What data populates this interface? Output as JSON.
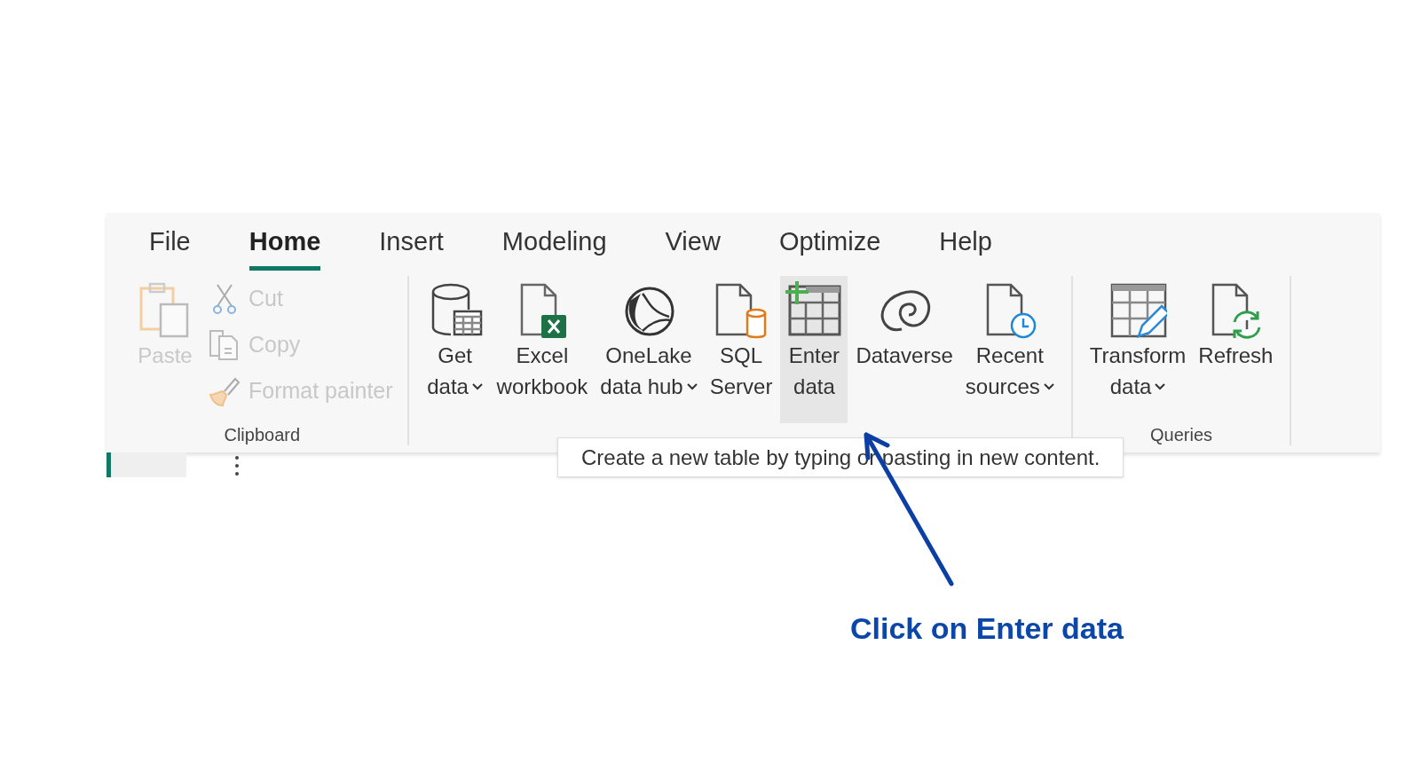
{
  "tabs": [
    {
      "label": "File",
      "selected": false
    },
    {
      "label": "Home",
      "selected": true
    },
    {
      "label": "Insert",
      "selected": false
    },
    {
      "label": "Modeling",
      "selected": false
    },
    {
      "label": "View",
      "selected": false
    },
    {
      "label": "Optimize",
      "selected": false
    },
    {
      "label": "Help",
      "selected": false
    }
  ],
  "groups": [
    {
      "label": "Clipboard",
      "items": [
        {
          "kind": "large",
          "lines": [
            "Paste"
          ],
          "disabled": true
        },
        {
          "kind": "small",
          "lines": [
            "Cut"
          ],
          "disabled": true
        },
        {
          "kind": "small",
          "lines": [
            "Copy"
          ],
          "disabled": true
        },
        {
          "kind": "small",
          "lines": [
            "Format painter"
          ],
          "disabled": true
        }
      ]
    },
    {
      "items": [
        {
          "kind": "large",
          "lines": [
            "Get",
            "data"
          ],
          "disabled": false,
          "dropdown": true,
          "highlighted": false
        },
        {
          "kind": "large",
          "lines": [
            "Excel",
            "workbook"
          ],
          "disabled": false,
          "dropdown": false,
          "highlighted": false
        },
        {
          "kind": "large",
          "lines": [
            "OneLake",
            "data hub"
          ],
          "disabled": false,
          "dropdown": true,
          "highlighted": false
        },
        {
          "kind": "large",
          "lines": [
            "SQL",
            "Server"
          ],
          "disabled": false,
          "dropdown": false,
          "highlighted": false
        },
        {
          "kind": "large",
          "lines": [
            "Enter",
            "data"
          ],
          "disabled": false,
          "dropdown": false,
          "highlighted": true
        },
        {
          "kind": "large",
          "lines": [
            "Dataverse"
          ],
          "disabled": false,
          "dropdown": false,
          "highlighted": false
        },
        {
          "kind": "large",
          "lines": [
            "Recent",
            "sources"
          ],
          "disabled": false,
          "dropdown": true,
          "highlighted": false
        }
      ]
    },
    {
      "label": "Queries",
      "items": [
        {
          "kind": "large",
          "lines": [
            "Transform",
            "data"
          ],
          "disabled": false,
          "dropdown": true,
          "highlighted": false
        },
        {
          "kind": "large",
          "lines": [
            "Refresh"
          ],
          "disabled": false,
          "dropdown": false,
          "highlighted": false
        }
      ]
    }
  ],
  "tooltip": "Create a new table by typing or pasting in new content.",
  "annotation": "Click on Enter data"
}
